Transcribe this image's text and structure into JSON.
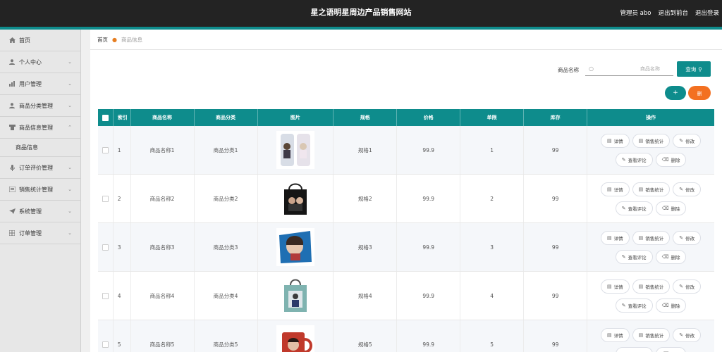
{
  "app": {
    "title": "星之语明星周边产品销售网站",
    "user": "管理员 abo",
    "back_to_frontend": "退出到前台",
    "logout": "退出登录"
  },
  "sidebar": {
    "items": [
      {
        "label": "首页",
        "icon": "home-icon",
        "expandable": false
      },
      {
        "label": "个人中心",
        "icon": "user-icon",
        "expandable": true
      },
      {
        "label": "用户管理",
        "icon": "users-icon",
        "expandable": true
      },
      {
        "label": "商品分类管理",
        "icon": "person-icon",
        "expandable": true
      },
      {
        "label": "商品信息管理",
        "icon": "gift-icon",
        "expandable": true,
        "open": true
      },
      {
        "label": "商品信息",
        "sub": true
      },
      {
        "label": "订单评价管理",
        "icon": "mic-icon",
        "expandable": true
      },
      {
        "label": "销售统计管理",
        "icon": "chart-icon",
        "expandable": true
      },
      {
        "label": "系统管理",
        "icon": "send-icon",
        "expandable": true
      },
      {
        "label": "订单管理",
        "icon": "grid-icon",
        "expandable": true
      }
    ]
  },
  "breadcrumb": {
    "home": "首页",
    "current": "商品信息"
  },
  "search": {
    "label": "商品名称",
    "placeholder": "商品名称",
    "button": "查询"
  },
  "actions": {
    "add": "+",
    "delete": "删"
  },
  "table": {
    "headers": [
      "索引",
      "商品名称",
      "商品分类",
      "图片",
      "规格",
      "价格",
      "单限",
      "库存",
      "操作"
    ],
    "rows": [
      {
        "index": "1",
        "name": "商品名称1",
        "category": "商品分类1",
        "spec": "规格1",
        "price": "99.9",
        "limit": "1",
        "stock": "99"
      },
      {
        "index": "2",
        "name": "商品名称2",
        "category": "商品分类2",
        "spec": "规格2",
        "price": "99.9",
        "limit": "2",
        "stock": "99"
      },
      {
        "index": "3",
        "name": "商品名称3",
        "category": "商品分类3",
        "spec": "规格3",
        "price": "99.9",
        "limit": "3",
        "stock": "99"
      },
      {
        "index": "4",
        "name": "商品名称4",
        "category": "商品分类4",
        "spec": "规格4",
        "price": "99.9",
        "limit": "4",
        "stock": "99"
      },
      {
        "index": "5",
        "name": "商品名称5",
        "category": "商品分类5",
        "spec": "规格5",
        "price": "99.9",
        "limit": "5",
        "stock": "99"
      }
    ],
    "ops": {
      "detail": "详情",
      "stats": "销售统计",
      "edit": "修改",
      "reviews": "查看评论",
      "delete": "删除"
    }
  },
  "colors": {
    "primary": "#0e8c8c",
    "danger": "#f37021",
    "topbar": "#232323"
  }
}
